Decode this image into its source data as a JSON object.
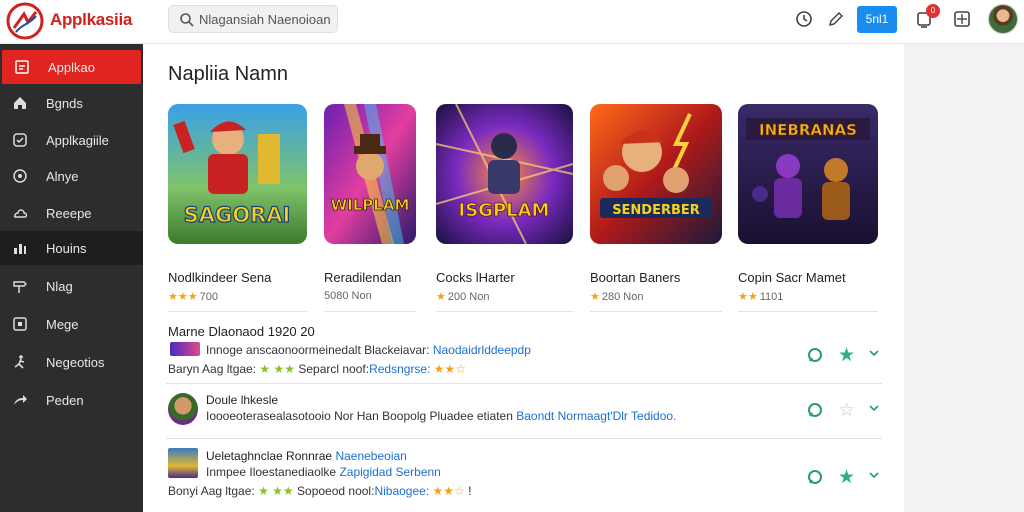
{
  "app": {
    "brand": "Applkasiia"
  },
  "search": {
    "text": "Nlagansiah Naenoioan"
  },
  "topbar": {
    "button_label": "5nl1",
    "notif_count": "0"
  },
  "sidebar": {
    "items": [
      {
        "label": "Applkao",
        "icon": "app-window-icon",
        "state": "active"
      },
      {
        "label": "Bgnds",
        "icon": "home-icon",
        "state": "normal"
      },
      {
        "label": "Applkagiile",
        "icon": "check-circle-icon",
        "state": "normal"
      },
      {
        "label": "Alnye",
        "icon": "circle-info-icon",
        "state": "normal"
      },
      {
        "label": "Reeepe",
        "icon": "cloud-icon",
        "state": "normal"
      },
      {
        "label": "Houins",
        "icon": "chart-icon",
        "state": "hover"
      },
      {
        "label": "Nlag",
        "icon": "signpost-icon",
        "state": "normal"
      },
      {
        "label": "Mege",
        "icon": "frame-icon",
        "state": "normal"
      },
      {
        "label": "Negeotios",
        "icon": "person-run-icon",
        "state": "normal"
      },
      {
        "label": "Peden",
        "icon": "share-arrow-icon",
        "state": "normal"
      }
    ]
  },
  "main": {
    "title": "Napliia Namn",
    "cards": [
      {
        "name": "Nodlkindeer Sena",
        "stars": "★★★",
        "rating": "700",
        "art_text": "SAGORAI"
      },
      {
        "name": "Reradilendan",
        "stars": "",
        "rating": "5080 Non",
        "art_text": "WILPLAM"
      },
      {
        "name": "Cocks lHarter",
        "stars": "★",
        "rating": "200 Non",
        "art_text": "ISGPLAM"
      },
      {
        "name": "Boortan Baners",
        "stars": "★",
        "rating": "280 Non",
        "art_text": "SENDERBER"
      },
      {
        "name": "Copin Sacr Mamet",
        "stars": "★★",
        "rating": "1101",
        "art_text": "INEBRANAS"
      }
    ],
    "list_header": "Marne Dlaonaod 1920 20",
    "rows": [
      {
        "line1": "Innoge anscaonoormeinedalt Blackeiavar:",
        "line1_link": "Naodaidrlddeepdp",
        "line2": "Baryn Aag ltgae:",
        "line2_mid": "Separcl noof:",
        "line2_link": "Redsngrse:",
        "starred": true
      },
      {
        "title": "Doule lhkesle",
        "line1": "Ioooeoterasealasotooio  Nor Han Boopolg Pluadee etiaten",
        "line1_link": "Baondt Normaagt'Dlr Tedidoo.",
        "starred": false
      },
      {
        "title": "Ueletaghnclae Ronnrae",
        "title_link": "Naenebeoian",
        "line1": "Inmpee Iloestanediaolke",
        "line1_link": "Zapigidad Serbenn",
        "line2": "Bonyi Aag ltgae:",
        "line2_mid": "Sopoeod nool:",
        "line2_link": "Nibaogee:",
        "starred": true
      }
    ]
  },
  "colors": {
    "accent": "#e0241f",
    "sidebar_bg": "#2d2d2d",
    "link": "#1b6fd1",
    "star_active": "#2bb08f",
    "primary_button": "#1a8cf0"
  }
}
